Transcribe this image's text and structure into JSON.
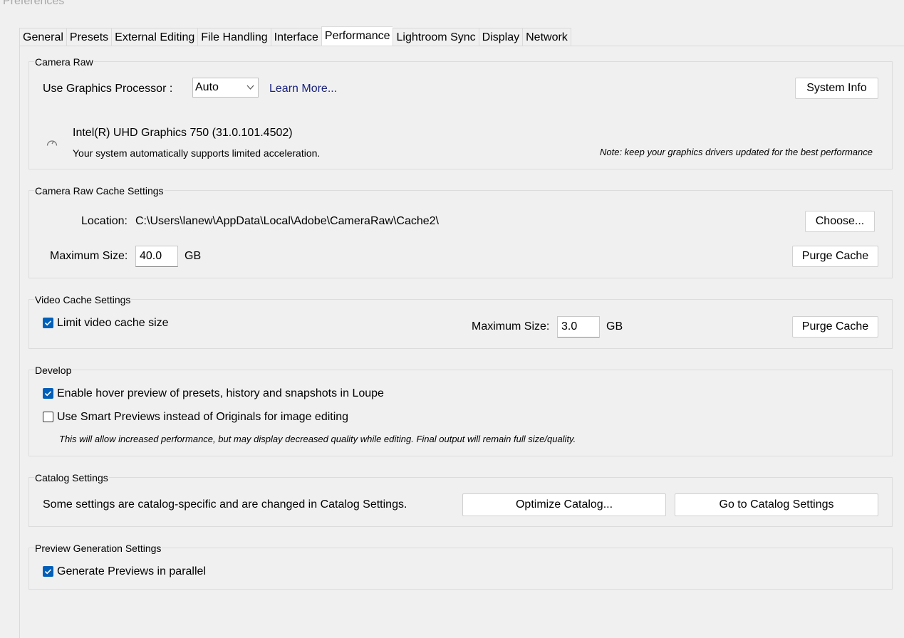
{
  "window": {
    "title": "Preferences"
  },
  "tabs": [
    {
      "label": "General"
    },
    {
      "label": "Presets"
    },
    {
      "label": "External Editing"
    },
    {
      "label": "File Handling"
    },
    {
      "label": "Interface"
    },
    {
      "label": "Performance"
    },
    {
      "label": "Lightroom Sync"
    },
    {
      "label": "Display"
    },
    {
      "label": "Network"
    }
  ],
  "active_tab": "Performance",
  "camera_raw": {
    "title": "Camera Raw",
    "gpu_label": "Use Graphics Processor :",
    "gpu_value": "Auto",
    "learn_more": "Learn More...",
    "system_info": "System Info",
    "gpu_name": "Intel(R) UHD Graphics 750 (31.0.101.4502)",
    "accel_text": "Your system automatically supports limited acceleration.",
    "note": "Note: keep your graphics drivers updated for the best performance",
    "icon": "gauge-icon"
  },
  "cache": {
    "title": "Camera Raw Cache Settings",
    "location_label": "Location:",
    "location_value": "C:\\Users\\lanew\\AppData\\Local\\Adobe\\CameraRaw\\Cache2\\",
    "choose": "Choose...",
    "max_label": "Maximum Size:",
    "max_value": "40.0",
    "unit": "GB",
    "purge": "Purge Cache"
  },
  "video_cache": {
    "title": "Video Cache Settings",
    "limit_label": "Limit video cache size",
    "limit_checked": true,
    "max_label": "Maximum Size:",
    "max_value": "3.0",
    "unit": "GB",
    "purge": "Purge Cache"
  },
  "develop": {
    "title": "Develop",
    "hover_label": "Enable hover preview of presets, history and snapshots in Loupe",
    "hover_checked": true,
    "smart_label": "Use Smart Previews instead of Originals for image editing",
    "smart_checked": false,
    "smart_note": "This will allow increased performance, but may display decreased quality while editing. Final output will remain full size/quality."
  },
  "catalog": {
    "title": "Catalog Settings",
    "text": "Some settings are catalog-specific and are changed in Catalog Settings.",
    "optimize": "Optimize Catalog...",
    "goto": "Go to Catalog Settings"
  },
  "preview": {
    "title": "Preview Generation Settings",
    "parallel_label": "Generate Previews in parallel",
    "parallel_checked": true
  },
  "colors": {
    "accent": "#005fb8",
    "link": "#1a237e",
    "background": "#f0f0f0"
  }
}
